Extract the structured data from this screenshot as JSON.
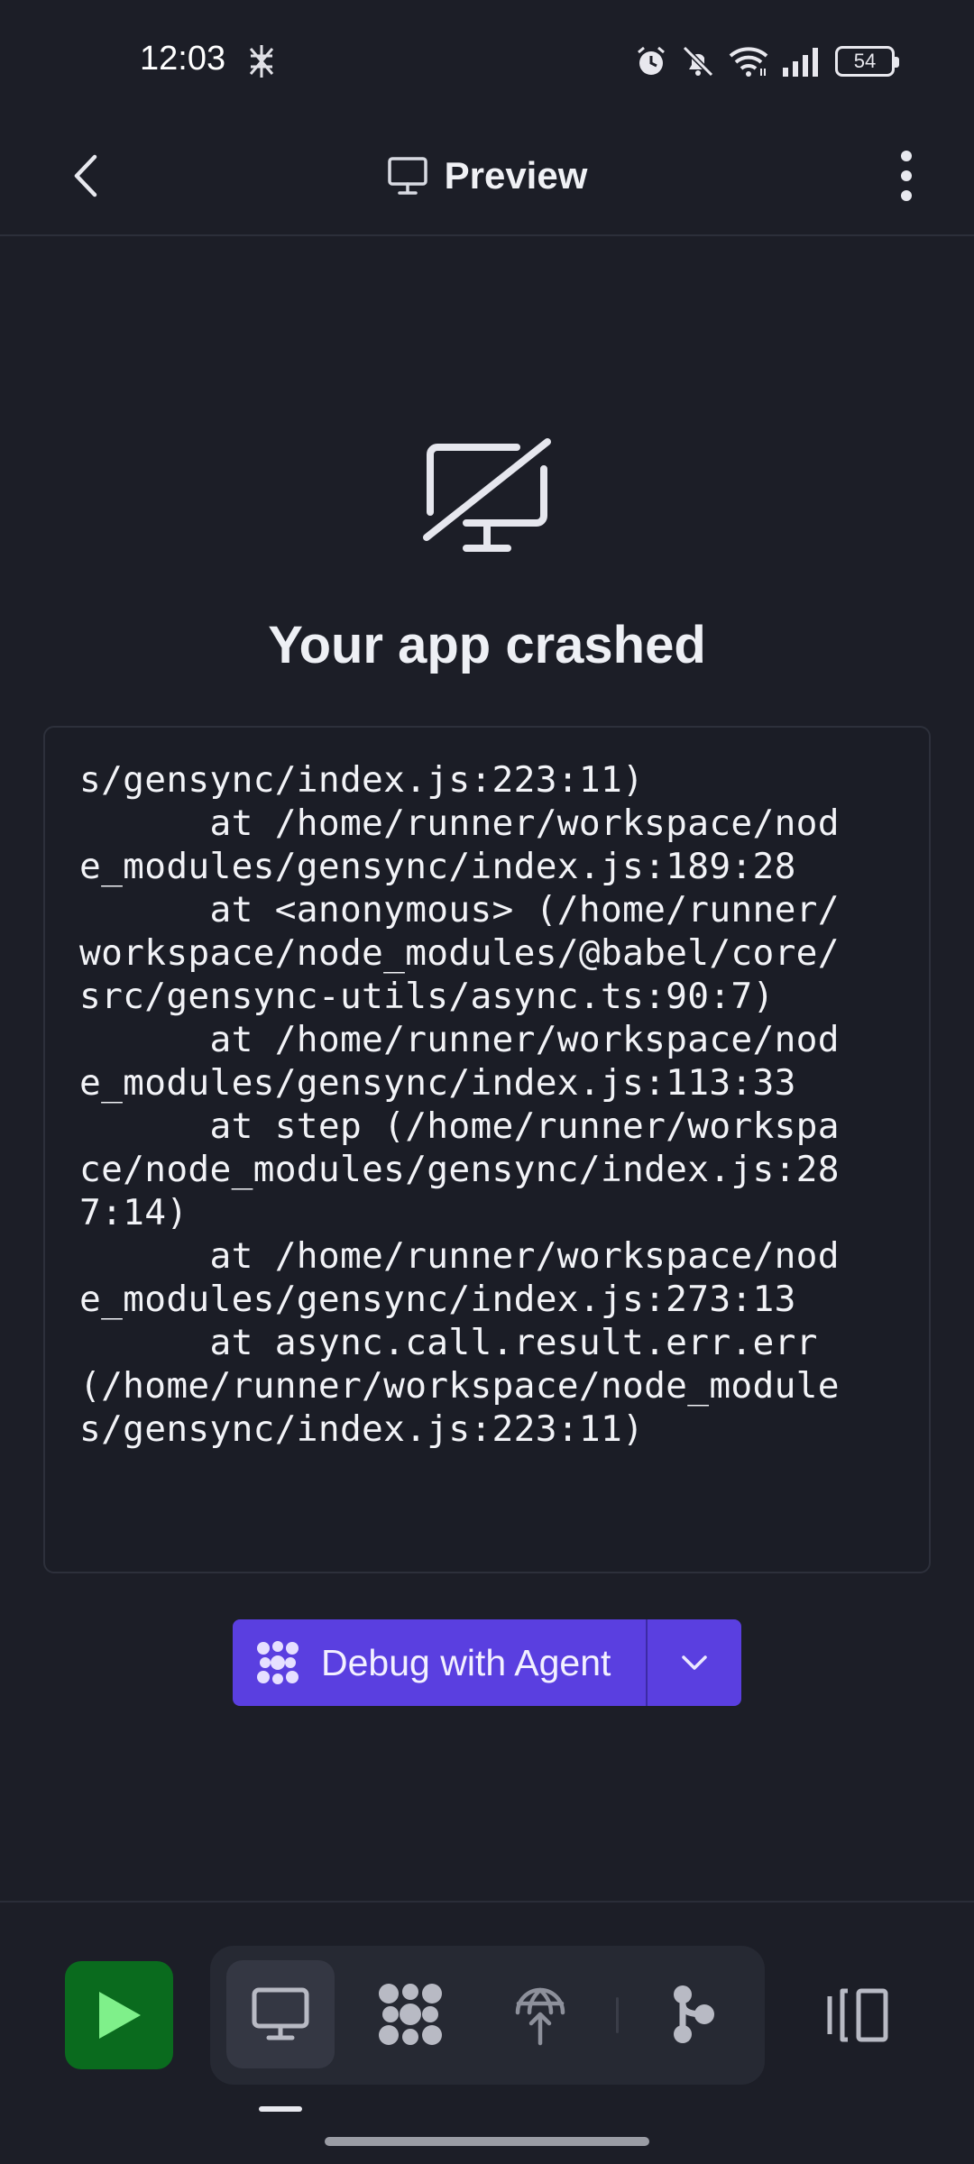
{
  "status_bar": {
    "time": "12:03",
    "battery": "54",
    "icons": [
      "alarm-icon",
      "muted-bell-icon",
      "wifi-icon",
      "signal-icon",
      "battery-icon"
    ]
  },
  "header": {
    "title": "Preview",
    "icons": [
      "back-chevron-icon",
      "monitor-icon",
      "more-vertical-icon"
    ]
  },
  "crash": {
    "title": "Your app crashed",
    "log_lines": [
      "s/gensync/index.js:223:11)",
      "      at /home/runner/workspace/nod",
      "e_modules/gensync/index.js:189:28",
      "      at <anonymous> (/home/runner/",
      "workspace/node_modules/@babel/core/",
      "src/gensync-utils/async.ts:90:7)",
      "      at /home/runner/workspace/nod",
      "e_modules/gensync/index.js:113:33",
      "      at step (/home/runner/workspa",
      "ce/node_modules/gensync/index.js:28",
      "7:14)",
      "      at /home/runner/workspace/nod",
      "e_modules/gensync/index.js:273:13",
      "      at async.call.result.err.err",
      "(/home/runner/workspace/node_module",
      "s/gensync/index.js:223:11)"
    ]
  },
  "debug_button": {
    "label": "Debug with Agent",
    "icon": "agent-icon",
    "dropdown_icon": "chevron-down-icon"
  },
  "bottom_toolbar": {
    "items": [
      "run-icon",
      "preview-monitor-icon",
      "agent-icon",
      "deploy-icon",
      "git-icon",
      "layout-icon"
    ],
    "active": "preview-monitor-icon"
  },
  "colors": {
    "background": "#1c1e27",
    "accent_purple": "#5a3fe0",
    "run_green": "#0a6b1e",
    "run_play": "#7ff08a"
  }
}
